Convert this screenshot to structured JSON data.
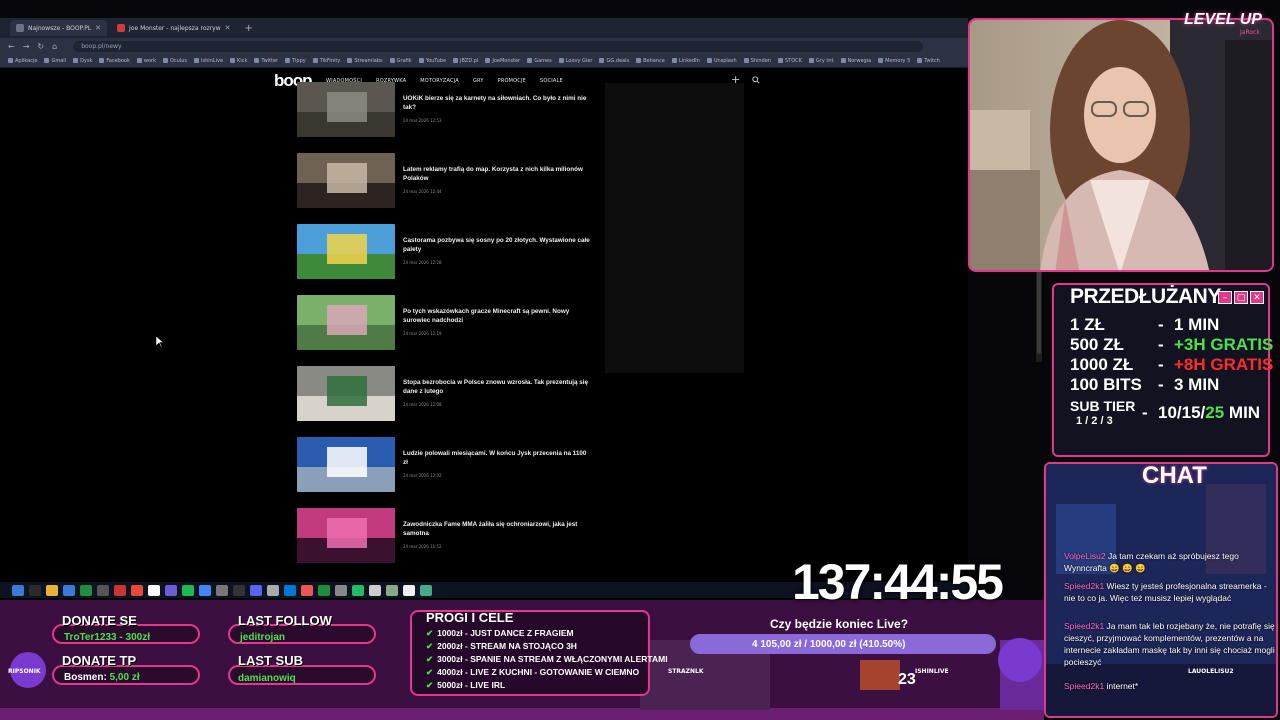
{
  "browser": {
    "tabs": [
      {
        "label": "Najnowsze - BOOP.PL",
        "active": true
      },
      {
        "label": "Joe Monster - najlepsza rozryw",
        "active": false
      }
    ],
    "url": "boop.pl/newy",
    "bookmarks": [
      "Aplikacje",
      "Gmail",
      "Dysk",
      "Facebook",
      "work",
      "Oculus",
      "IshinLive",
      "Kick",
      "Twitter",
      "Tippy",
      "TikFinity",
      "Streamlabs",
      "Grafik",
      "YouTube",
      "JBZD.pl",
      "JoeMonster",
      "Games",
      "Loovy Gier",
      "GG.deals",
      "Behance",
      "LinkedIn",
      "Unsplash",
      "Shinden",
      "STOCK",
      "Gry tnt",
      "Norwegia",
      "Memory 5",
      "Twitch"
    ]
  },
  "site": {
    "logo": "boop",
    "nav": [
      "WIADOMOŚCI",
      "ROZRYWKA",
      "MOTORYZACJA",
      "GRY",
      "PROMOCJE",
      "SOCIALE"
    ],
    "articles": [
      {
        "title": "UOKiK bierze się za karnety na siłowniach. Co było z nimi nie tak?",
        "date": "24 mar 2026 12:53"
      },
      {
        "title": "Latem reklamy trafią do map. Korzysta z nich kilka milionów Polaków",
        "date": "24 mar 2026 12:44"
      },
      {
        "title": "Castorama pozbywa się sosny po 20 złotych. Wystawione całe palety",
        "date": "24 mar 2026 12:28"
      },
      {
        "title": "Po tych wskazówkach gracze Minecraft są pewni. Nowy surowiec nadchodzi",
        "date": "24 mar 2026 12:19"
      },
      {
        "title": "Stopa bezrobocia w Polsce znowu wzrosła. Tak prezentują się dane z lutego",
        "date": "24 mar 2026 12:08"
      },
      {
        "title": "Ludzie polowali miesiącami. W końcu Jysk przecenia na 1100 zł",
        "date": "24 mar 2026 12:02"
      },
      {
        "title": "Zawodniczka Fame MMA żaliła się ochroniarzowi, jaka jest samotna",
        "date": "24 mar 2026 11:52"
      }
    ]
  },
  "overlay": {
    "levelup": "LEVEL UP",
    "levelup_sub": "JaRock",
    "pricing": {
      "title": "PRZEDŁUŻANY",
      "rows": [
        {
          "amount": "1 ZŁ",
          "dash": "-",
          "value": "1 MIN",
          "extra": ""
        },
        {
          "amount": "500 ZŁ",
          "dash": "-",
          "value": "+3H GRATIS",
          "extra": ""
        },
        {
          "amount": "1000 ZŁ",
          "dash": "-",
          "value": "+8H GRATIS",
          "extra": ""
        },
        {
          "amount": "100 BITS",
          "dash": "-",
          "value": "3 MIN",
          "extra": ""
        }
      ],
      "subtier_label": "SUB TIER",
      "subtier_tiers": "1 / 2 / 3",
      "subtier_dash": "-",
      "subtier_value_a": "10/15/",
      "subtier_value_b": "25",
      "subtier_value_c": " MIN"
    },
    "chat": {
      "title": "CHAT",
      "messages": [
        {
          "user": "VolpeLisu2",
          "text": "Ja tam czekam aż spróbujesz tego Wynncrafta 😄 😄 😄"
        },
        {
          "user": "Spieed2k1",
          "text": "Wiesz ty jesteś profesjonalna streamerka - nie to co ja. Więc też musisz lepiej wyglądać"
        },
        {
          "user": "Spieed2k1",
          "text": "Ja mam tak leb rozjebany że, nie potrafię się cieszyć, przyjmować komplementów, prezentów a na internecie zakładam maskę tak by inni się chociaż mogli pocieszyć"
        },
        {
          "user": "Spieed2k1",
          "text": "internet*"
        }
      ]
    },
    "timer": "137:44:55",
    "donate_se": {
      "label": "DONATE SE",
      "value": "TroTer1233 - 300zł"
    },
    "donate_tp": {
      "label": "DONATE TP",
      "name": "Bosmen:",
      "value": " 5,00 zł"
    },
    "last_follow": {
      "label": "LAST FOLLOW",
      "value": "jeditrojan"
    },
    "last_sub": {
      "label": "LAST SUB",
      "value": "damianowiq"
    },
    "goals": {
      "title": "PROGI I CELE",
      "items": [
        "1000zł - JUST DANCE Z FRAGIEM",
        "2000zł - STREAM NA STOJĄCO 3H",
        "3000zł - SPANIE NA STREAM Z WŁĄCZONYMI ALERTAMI",
        "4000zł - LIVE Z KUCHNI - GOTOWANIE W CIEMNO",
        "5000zł - LIVE IRL"
      ]
    },
    "poll": {
      "question": "Czy będzie koniec Live?",
      "value_text": "4 105,00 zł / 1000,00 zł (410.50%)",
      "progress": 1.0
    },
    "game_labels": [
      "RIPSONIK",
      "STRAZNLK",
      "ISHINLIVE",
      "23",
      "LAUOLELISU2"
    ]
  },
  "colors": {
    "accent": "#e0388a",
    "green": "#4de04a",
    "red": "#ff2b2b",
    "poll": "#8a6ad8"
  }
}
